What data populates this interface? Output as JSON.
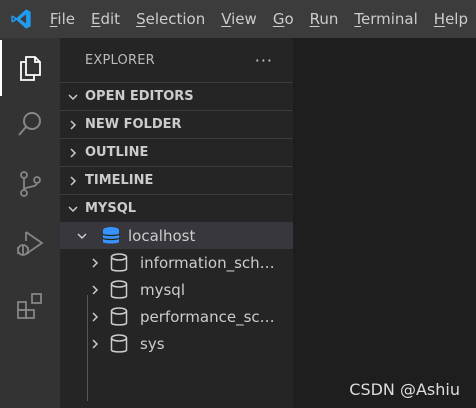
{
  "menubar": {
    "items": [
      {
        "acc": "F",
        "rest": "ile"
      },
      {
        "acc": "E",
        "rest": "dit"
      },
      {
        "acc": "S",
        "rest": "election"
      },
      {
        "acc": "V",
        "rest": "iew"
      },
      {
        "acc": "G",
        "rest": "o"
      },
      {
        "acc": "R",
        "rest": "un"
      },
      {
        "acc": "T",
        "rest": "erminal"
      },
      {
        "acc": "H",
        "rest": "elp"
      }
    ]
  },
  "activitybar": {
    "icons": [
      "explorer-icon",
      "search-icon",
      "source-control-icon",
      "run-debug-icon",
      "extensions-icon"
    ],
    "active": "explorer-icon"
  },
  "sidebar": {
    "title": "EXPLORER",
    "more": "···",
    "sections": [
      {
        "label": "OPEN EDITORS",
        "expanded": true
      },
      {
        "label": "NEW FOLDER",
        "expanded": false
      },
      {
        "label": "OUTLINE",
        "expanded": false
      },
      {
        "label": "TIMELINE",
        "expanded": false
      },
      {
        "label": "MYSQL",
        "expanded": true
      }
    ],
    "connection": {
      "label": "localhost",
      "expanded": true
    },
    "databases": [
      "information_sche...",
      "mysql",
      "performance_sch...",
      "sys"
    ]
  },
  "watermark": "CSDN @Ashiu",
  "colors": {
    "accent_db": "#3794ff",
    "titlebar": "#3c3c3c",
    "activitybar": "#333333",
    "sidebar": "#252526",
    "editor": "#1e1e1e"
  }
}
